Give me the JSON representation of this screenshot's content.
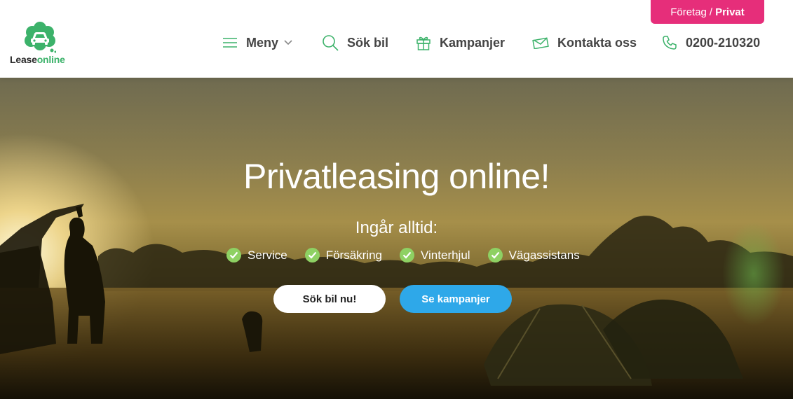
{
  "header": {
    "logo": {
      "lease": "Lease",
      "online": "online",
      "icon": "car-cloud-logo-icon"
    },
    "switch": {
      "foretag": "Företag",
      "separator": "/",
      "privat": "Privat"
    },
    "nav": {
      "menu": {
        "label": "Meny",
        "icon": "hamburger-icon",
        "chevron": "chevron-down-icon"
      },
      "search": {
        "label": "Sök bil",
        "icon": "search-icon"
      },
      "campaigns": {
        "label": "Kampanjer",
        "icon": "gift-icon"
      },
      "contact": {
        "label": "Kontakta oss",
        "icon": "envelope-icon"
      },
      "phone": {
        "label": "0200-210320",
        "icon": "phone-icon"
      }
    }
  },
  "hero": {
    "title": "Privatleasing online!",
    "subtitle": "Ingår alltid:",
    "features": [
      "Service",
      "Försäkring",
      "Vinterhjul",
      "Vägassistans"
    ],
    "buttons": {
      "search": "Sök bil nu!",
      "campaigns": "Se kampanjer"
    }
  },
  "colors": {
    "brand_green": "#3cb26a",
    "switch_pink": "#e62e7a",
    "check_green": "#8ed163",
    "button_blue": "#2ea8e9"
  }
}
